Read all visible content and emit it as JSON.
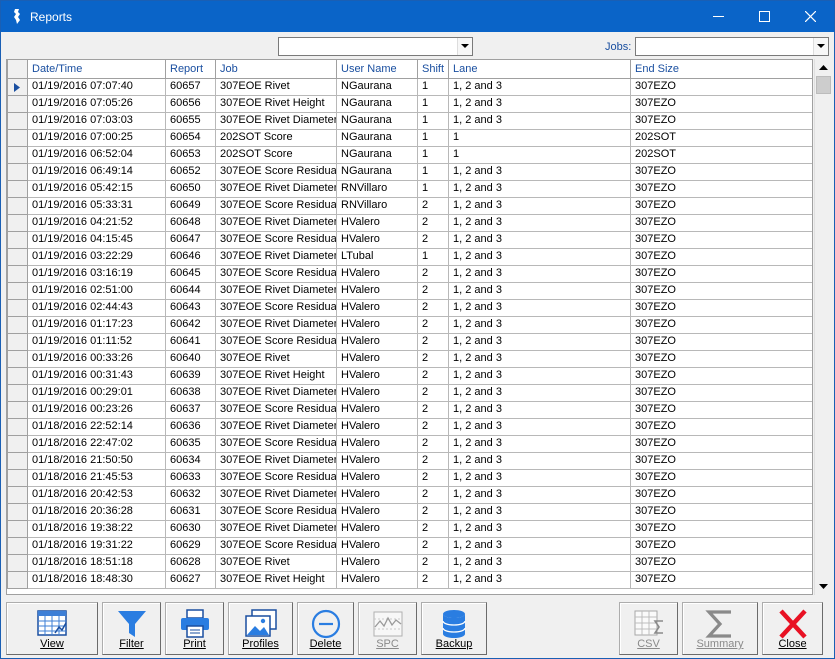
{
  "window": {
    "title": "Reports"
  },
  "filters": {
    "left_combo_value": "",
    "jobs_label": "Jobs:",
    "jobs_value": ""
  },
  "grid": {
    "columns": [
      "Date/Time",
      "Report",
      "Job",
      "User Name",
      "Shift",
      "Lane",
      "End Size"
    ],
    "rows": [
      [
        "01/19/2016 07:07:40",
        "60657",
        "307EOE Rivet",
        "NGaurana",
        "1",
        "1, 2 and 3",
        "307EZO"
      ],
      [
        "01/19/2016 07:05:26",
        "60656",
        "307EOE Rivet Height",
        "NGaurana",
        "1",
        "1, 2 and 3",
        "307EZO"
      ],
      [
        "01/19/2016 07:03:03",
        "60655",
        "307EOE Rivet Diameter",
        "NGaurana",
        "1",
        "1, 2 and 3",
        "307EZO"
      ],
      [
        "01/19/2016 07:00:25",
        "60654",
        "202SOT Score",
        "NGaurana",
        "1",
        "1",
        "202SOT"
      ],
      [
        "01/19/2016 06:52:04",
        "60653",
        "202SOT Score",
        "NGaurana",
        "1",
        "1",
        "202SOT"
      ],
      [
        "01/19/2016 06:49:14",
        "60652",
        "307EOE Score Residual",
        "NGaurana",
        "1",
        "1, 2 and 3",
        "307EZO"
      ],
      [
        "01/19/2016 05:42:15",
        "60650",
        "307EOE Rivet Diameter",
        "RNVillaro",
        "1",
        "1, 2 and 3",
        "307EZO"
      ],
      [
        "01/19/2016 05:33:31",
        "60649",
        "307EOE Score Residual",
        "RNVillaro",
        "2",
        "1, 2 and 3",
        "307EZO"
      ],
      [
        "01/19/2016 04:21:52",
        "60648",
        "307EOE Rivet Diameter",
        "HValero",
        "2",
        "1, 2 and 3",
        "307EZO"
      ],
      [
        "01/19/2016 04:15:45",
        "60647",
        "307EOE Score Residual",
        "HValero",
        "2",
        "1, 2 and 3",
        "307EZO"
      ],
      [
        "01/19/2016 03:22:29",
        "60646",
        "307EOE Rivet Diameter",
        "LTubal",
        "1",
        "1, 2 and 3",
        "307EZO"
      ],
      [
        "01/19/2016 03:16:19",
        "60645",
        "307EOE Score Residual",
        "HValero",
        "2",
        "1, 2 and 3",
        "307EZO"
      ],
      [
        "01/19/2016 02:51:00",
        "60644",
        "307EOE Rivet Diameter",
        "HValero",
        "2",
        "1, 2 and 3",
        "307EZO"
      ],
      [
        "01/19/2016 02:44:43",
        "60643",
        "307EOE Score Residual",
        "HValero",
        "2",
        "1, 2 and 3",
        "307EZO"
      ],
      [
        "01/19/2016 01:17:23",
        "60642",
        "307EOE Rivet Diameter",
        "HValero",
        "2",
        "1, 2 and 3",
        "307EZO"
      ],
      [
        "01/19/2016 01:11:52",
        "60641",
        "307EOE Score Residual",
        "HValero",
        "2",
        "1, 2 and 3",
        "307EZO"
      ],
      [
        "01/19/2016 00:33:26",
        "60640",
        "307EOE Rivet",
        "HValero",
        "2",
        "1, 2 and 3",
        "307EZO"
      ],
      [
        "01/19/2016 00:31:43",
        "60639",
        "307EOE Rivet Height",
        "HValero",
        "2",
        "1, 2 and 3",
        "307EZO"
      ],
      [
        "01/19/2016 00:29:01",
        "60638",
        "307EOE Rivet Diameter",
        "HValero",
        "2",
        "1, 2 and 3",
        "307EZO"
      ],
      [
        "01/19/2016 00:23:26",
        "60637",
        "307EOE Score Residual",
        "HValero",
        "2",
        "1, 2 and 3",
        "307EZO"
      ],
      [
        "01/18/2016 22:52:14",
        "60636",
        "307EOE Rivet Diameter",
        "HValero",
        "2",
        "1, 2 and 3",
        "307EZO"
      ],
      [
        "01/18/2016 22:47:02",
        "60635",
        "307EOE Score Residual",
        "HValero",
        "2",
        "1, 2 and 3",
        "307EZO"
      ],
      [
        "01/18/2016 21:50:50",
        "60634",
        "307EOE Rivet Diameter",
        "HValero",
        "2",
        "1, 2 and 3",
        "307EZO"
      ],
      [
        "01/18/2016 21:45:53",
        "60633",
        "307EOE Score Residual",
        "HValero",
        "2",
        "1, 2 and 3",
        "307EZO"
      ],
      [
        "01/18/2016 20:42:53",
        "60632",
        "307EOE Rivet Diameter",
        "HValero",
        "2",
        "1, 2 and 3",
        "307EZO"
      ],
      [
        "01/18/2016 20:36:28",
        "60631",
        "307EOE Score Residual",
        "HValero",
        "2",
        "1, 2 and 3",
        "307EZO"
      ],
      [
        "01/18/2016 19:38:22",
        "60630",
        "307EOE Rivet Diameter",
        "HValero",
        "2",
        "1, 2 and 3",
        "307EZO"
      ],
      [
        "01/18/2016 19:31:22",
        "60629",
        "307EOE Score Residual",
        "HValero",
        "2",
        "1, 2 and 3",
        "307EZO"
      ],
      [
        "01/18/2016 18:51:18",
        "60628",
        "307EOE Rivet",
        "HValero",
        "2",
        "1, 2 and 3",
        "307EZO"
      ],
      [
        "01/18/2016 18:48:30",
        "60627",
        "307EOE Rivet Height",
        "HValero",
        "2",
        "1, 2 and 3",
        "307EZO"
      ]
    ]
  },
  "toolbar": {
    "view": "View",
    "filter": "Filter",
    "print": "Print",
    "profiles": "Profiles",
    "delete": "Delete",
    "spc": "SPC",
    "backup": "Backup",
    "csv": "CSV",
    "summary": "Summary",
    "close": "Close"
  },
  "icons": {
    "app": "app-icon",
    "minimize": "minimize-icon",
    "maximize": "maximize-icon",
    "close": "close-icon",
    "view": "grid-view-icon",
    "filter": "funnel-icon",
    "print": "printer-icon",
    "profiles": "pictures-icon",
    "delete": "minus-circle-icon",
    "spc": "chart-icon",
    "backup": "database-icon",
    "csv": "spreadsheet-sum-icon",
    "summary": "sigma-icon",
    "close_btn": "red-x-icon"
  },
  "colors": {
    "titlebar": "#0a64c8",
    "header_text": "#1a4fa0",
    "close_red": "#e81123"
  }
}
